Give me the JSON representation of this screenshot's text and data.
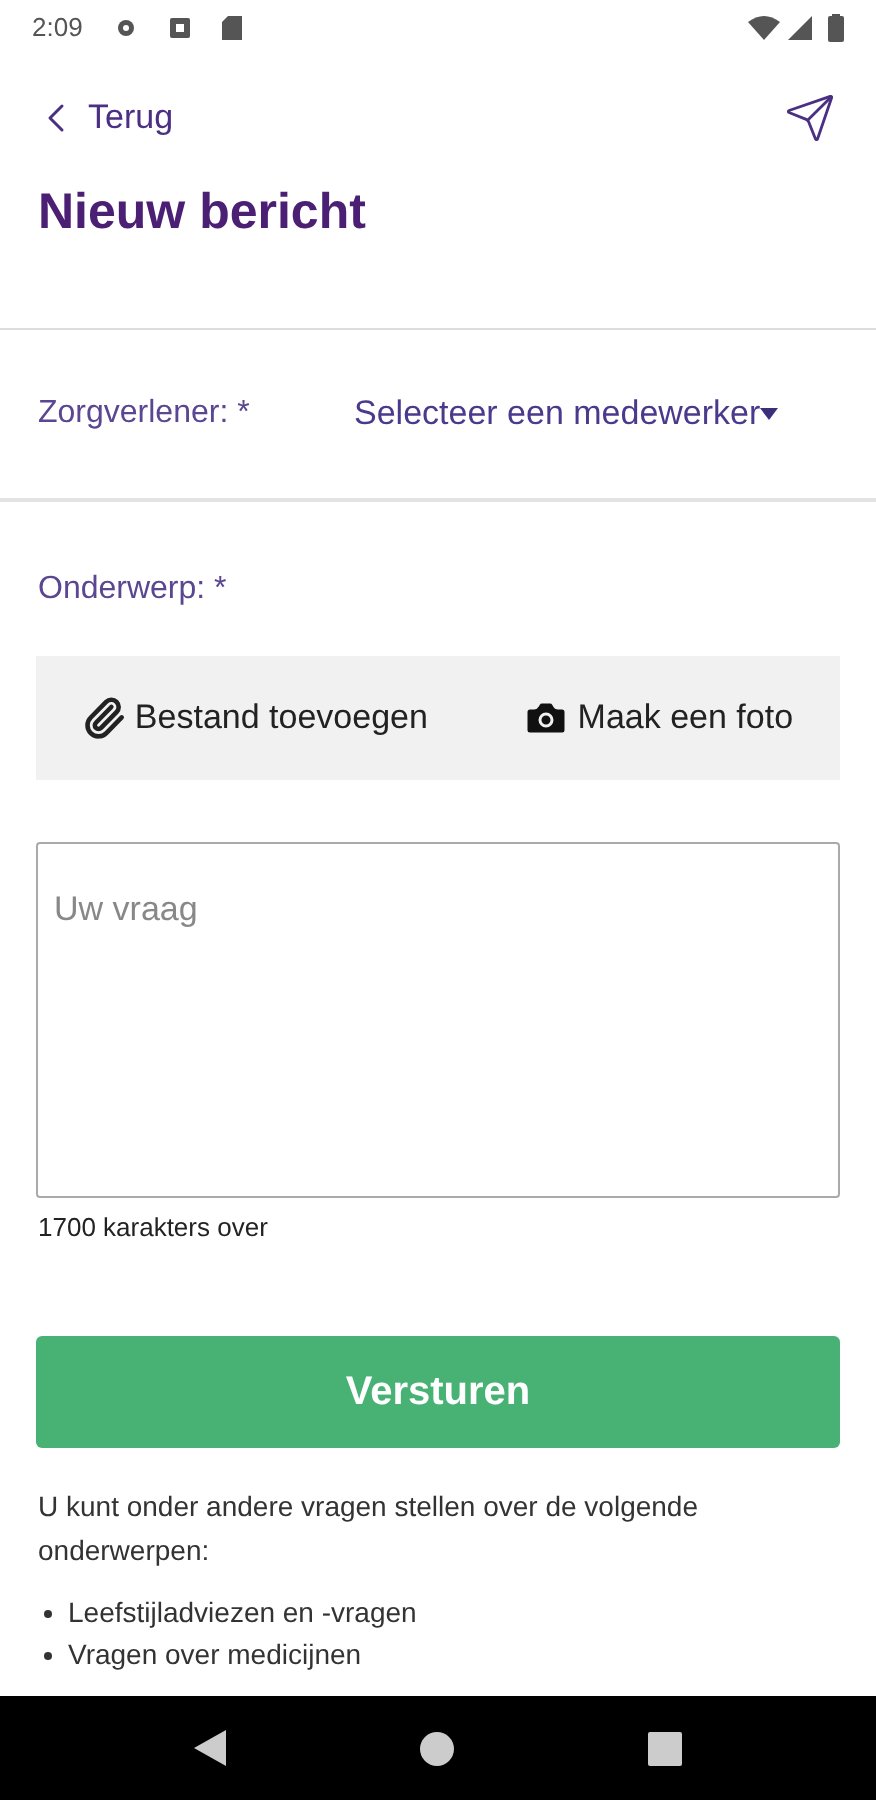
{
  "status_bar": {
    "time": "2:09"
  },
  "header": {
    "back": "Terug",
    "title": "Nieuw bericht"
  },
  "form": {
    "caregiver_label": "Zorgverlener: *",
    "caregiver_select": "Selecteer een medewerker",
    "subject_label": "Onderwerp: *",
    "attach_buttons": [
      {
        "kind": "file",
        "label": "Bestand toevoegen"
      },
      {
        "kind": "photo",
        "label": "Maak een foto"
      }
    ],
    "question": {
      "placeholder": "Uw vraag"
    },
    "remaining": "1700 karakters over",
    "submit": "Versturen"
  },
  "info": {
    "intro": "U kunt onder andere vragen stellen over de volgende onderwerpen:",
    "bullets": [
      "Leefstijladviezen en -vragen",
      "Vragen over medicijnen"
    ]
  }
}
